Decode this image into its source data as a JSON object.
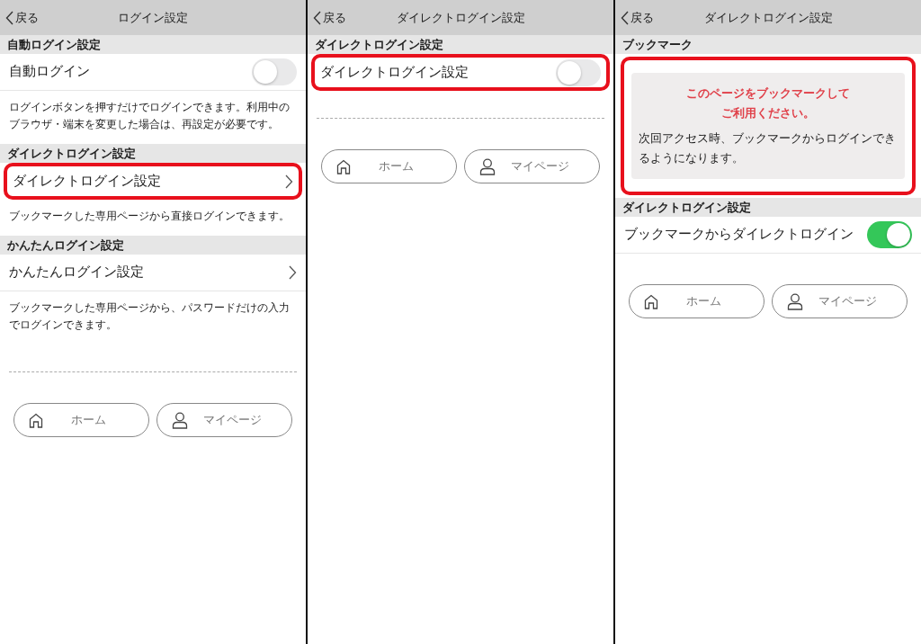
{
  "panels": [
    {
      "back": "戻る",
      "title": "ログイン設定",
      "blocks": [
        {
          "kind": "heading",
          "text": "自動ログイン設定"
        },
        {
          "kind": "toggle",
          "label": "自動ログイン",
          "on": false,
          "highlighted": false
        },
        {
          "kind": "note",
          "text": "ログインボタンを押すだけでログインできます。利用中のブラウザ・端末を変更した場合は、再設定が必要です。"
        },
        {
          "kind": "heading",
          "text": "ダイレクトログイン設定"
        },
        {
          "kind": "link",
          "label": "ダイレクトログイン設定",
          "highlighted": true
        },
        {
          "kind": "note",
          "text": "ブックマークした専用ページから直接ログインできます。"
        },
        {
          "kind": "heading",
          "text": "かんたんログイン設定"
        },
        {
          "kind": "link",
          "label": "かんたんログイン設定",
          "highlighted": false
        },
        {
          "kind": "note",
          "text": "ブックマークした専用ページから、パスワードだけの入力でログインできます。"
        },
        {
          "kind": "rule"
        }
      ],
      "nav": [
        {
          "kind": "home",
          "label": "ホーム"
        },
        {
          "kind": "mypage",
          "label": "マイページ"
        }
      ]
    },
    {
      "back": "戻る",
      "title": "ダイレクトログイン設定",
      "blocks": [
        {
          "kind": "heading",
          "text": "ダイレクトログイン設定"
        },
        {
          "kind": "toggle",
          "label": "ダイレクトログイン設定",
          "on": false,
          "highlighted": true
        },
        {
          "kind": "rule"
        }
      ],
      "nav": [
        {
          "kind": "home",
          "label": "ホーム"
        },
        {
          "kind": "mypage",
          "label": "マイページ"
        }
      ]
    },
    {
      "back": "戻る",
      "title": "ダイレクトログイン設定",
      "blocks": [
        {
          "kind": "heading",
          "text": "ブックマーク"
        },
        {
          "kind": "bookmark",
          "title_lines": [
            "このページをブックマークして",
            "ご利用ください。"
          ],
          "text": "次回アクセス時、ブックマークからログインできるようになります。",
          "highlighted": true
        },
        {
          "kind": "heading",
          "text": "ダイレクトログイン設定"
        },
        {
          "kind": "toggle",
          "label": "ブックマークからダイレクトログイン",
          "on": true,
          "highlighted": false
        }
      ],
      "nav": [
        {
          "kind": "home",
          "label": "ホーム"
        },
        {
          "kind": "mypage",
          "label": "マイページ"
        }
      ]
    }
  ]
}
